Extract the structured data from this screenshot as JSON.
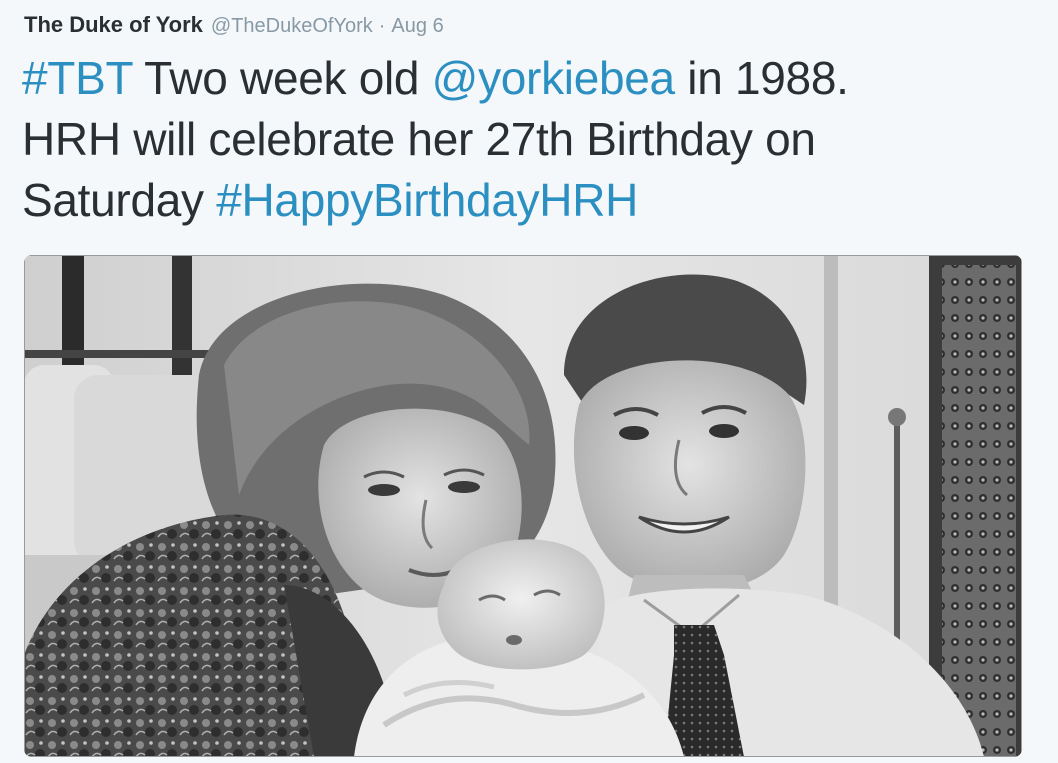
{
  "tweet": {
    "author": {
      "display_name": "The Duke of York",
      "username": "@TheDukeOfYork"
    },
    "separator": "·",
    "timestamp": "Aug 6",
    "text_lines": [
      [
        {
          "text": "#TBT",
          "type": "hashtag"
        },
        {
          "text": " Two week old ",
          "type": "text"
        },
        {
          "text": "@yorkiebea",
          "type": "mention"
        },
        {
          "text": " in 1988.",
          "type": "text"
        }
      ],
      [
        {
          "text": "HRH will celebrate her 27th Birthday on",
          "type": "text"
        }
      ],
      [
        {
          "text": "Saturday ",
          "type": "text"
        },
        {
          "text": "#HappyBirthdayHRH",
          "type": "hashtag"
        }
      ]
    ],
    "media": {
      "kind": "black-and-white family photo"
    }
  },
  "colors": {
    "background": "#f5f8fa",
    "text": "#292f33",
    "link": "#2b8fc1",
    "secondary": "#8899a6"
  }
}
